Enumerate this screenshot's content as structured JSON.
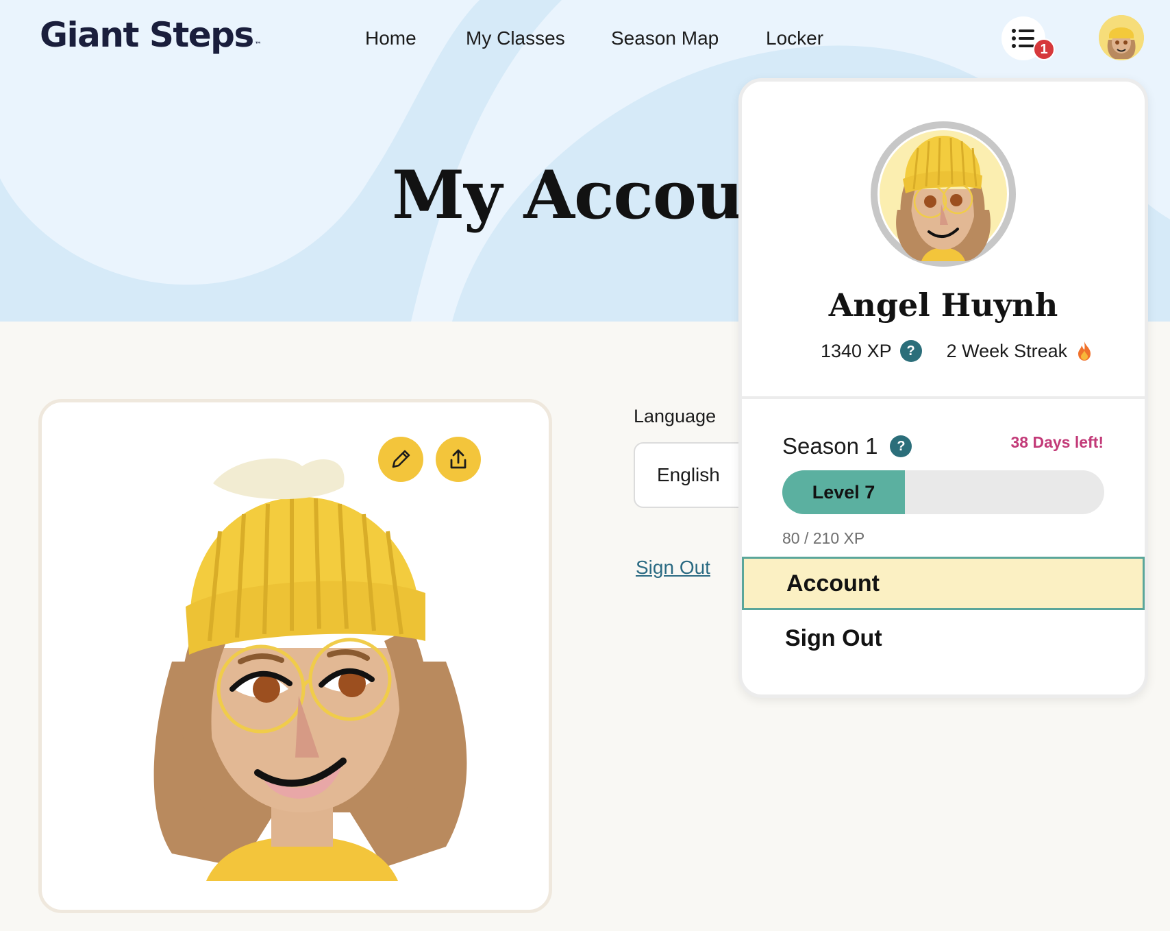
{
  "brand": {
    "name": "Giant Steps",
    "tm": "™"
  },
  "nav": {
    "items": [
      {
        "label": "Home"
      },
      {
        "label": "My Classes"
      },
      {
        "label": "Season Map"
      },
      {
        "label": "Locker"
      }
    ]
  },
  "notifications": {
    "count": "1"
  },
  "page": {
    "title": "My Account"
  },
  "settings": {
    "language_label": "Language",
    "language_value": "English",
    "sign_out_link": "Sign Out"
  },
  "profile_menu": {
    "name": "Angel Huynh",
    "xp": "1340 XP",
    "streak": "2 Week Streak",
    "help_glyph": "?",
    "season_label": "Season 1",
    "days_left": "38 Days left!",
    "level_label": "Level 7",
    "level_progress_fraction": 0.381,
    "xp_progress": "80 / 210 XP",
    "items": [
      {
        "label": "Account",
        "selected": true
      },
      {
        "label": "Sign Out",
        "selected": false
      }
    ]
  },
  "icons": [
    "list-icon",
    "avatar-icon",
    "pencil-icon",
    "share-icon",
    "help-icon",
    "flame-icon"
  ],
  "colors": {
    "hero_bg": "#d6eaf8",
    "accent_yellow": "#f3c53b",
    "teal": "#5bb0a0",
    "badge_red": "#d6383b",
    "days_left_pink": "#c23a78",
    "link_teal": "#2a6a82"
  }
}
